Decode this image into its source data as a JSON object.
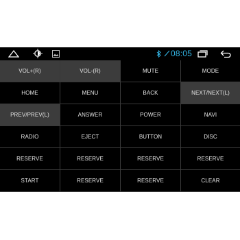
{
  "statusbar": {
    "icons": [
      "home-icon",
      "brightness-icon",
      "picture-icon",
      "bluetooth-icon",
      "signal-icon",
      "recent-apps-icon",
      "back-icon"
    ],
    "time": "08:05"
  },
  "buttons": [
    [
      "VOL+(R)",
      "VOL-(R)",
      "MUTE",
      "MODE"
    ],
    [
      "HOME",
      "MENU",
      "BACK",
      "NEXT/NEXT(L)"
    ],
    [
      "PREV/PREV(L)",
      "ANSWER",
      "POWER",
      "NAVI"
    ],
    [
      "RADIO",
      "EJECT",
      "BUTTON",
      "DISC"
    ],
    [
      "RESERVE",
      "RESERVE",
      "RESERVE",
      "RESERVE"
    ],
    [
      "START",
      "RESERVE",
      "RESERVE",
      "CLEAR"
    ]
  ],
  "highlighted": [
    "VOL+(R)",
    "VOL-(R)",
    "NEXT/NEXT(L)",
    "PREV/PREV(L)"
  ],
  "colors": {
    "background": "#000000",
    "text": "#e6e6e6",
    "highlight": "#3c3c3c",
    "divider": "#3a3a3a",
    "clock": "#33b5e5"
  }
}
